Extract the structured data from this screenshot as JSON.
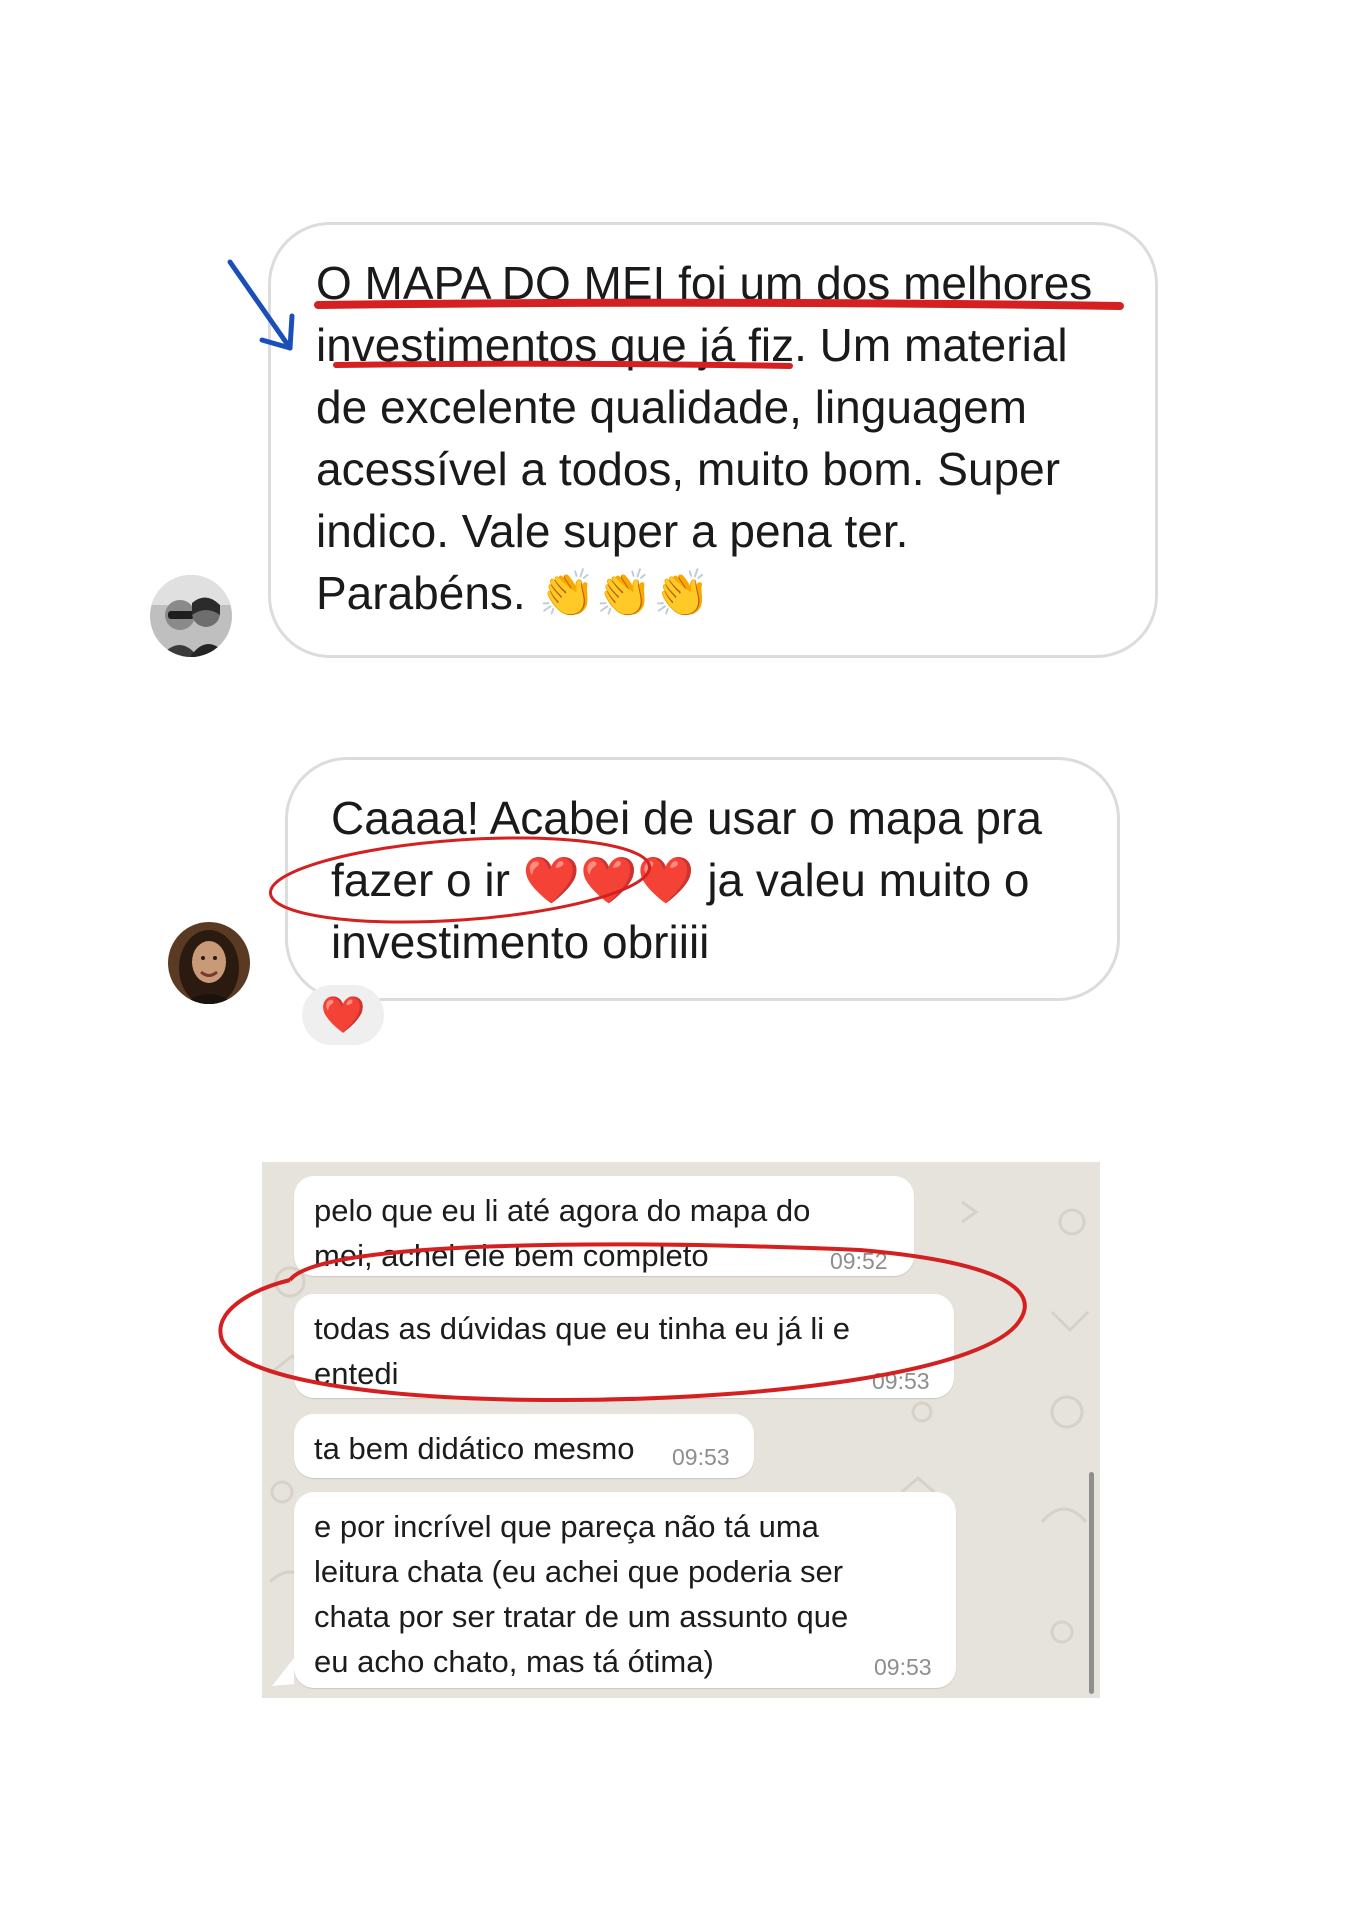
{
  "comment_1": {
    "lines": [
      "O MAPA DO MEI foi um dos melhores",
      "investimentos que já fiz. Um material",
      "de excelente qualidade, linguagem",
      "acessível a todos, muito bom. Super",
      "indico. Vale super a pena ter.",
      "Parabéns. 👏👏👏"
    ]
  },
  "comment_2": {
    "lines": [
      "Caaaa! Acabei de usar o mapa pra",
      "fazer o ir ❤️❤️❤️ ja valeu muito o",
      "investimento obriiii"
    ],
    "reaction": "❤️"
  },
  "whatsapp": {
    "messages": [
      {
        "lines": [
          "pelo que eu li até agora do mapa do",
          "mei, achei ele bem completo"
        ],
        "time": "09:52"
      },
      {
        "lines": [
          "todas as dúvidas que eu tinha eu já li e",
          "entedi"
        ],
        "time": "09:53"
      },
      {
        "lines": [
          "ta bem didático mesmo"
        ],
        "time": "09:53"
      },
      {
        "lines": [
          "e por incrível que pareça não tá uma",
          "leitura chata (eu achei que poderia ser",
          "chata por ser tratar de um assunto que",
          "eu acho chato, mas tá ótima)"
        ],
        "time": "09:53"
      }
    ]
  },
  "colors": {
    "highlight_red": "#d42020",
    "arrow_blue": "#1b4fb8",
    "wa_background": "#e6e2dc",
    "bubble_border": "#dcdcdc"
  }
}
